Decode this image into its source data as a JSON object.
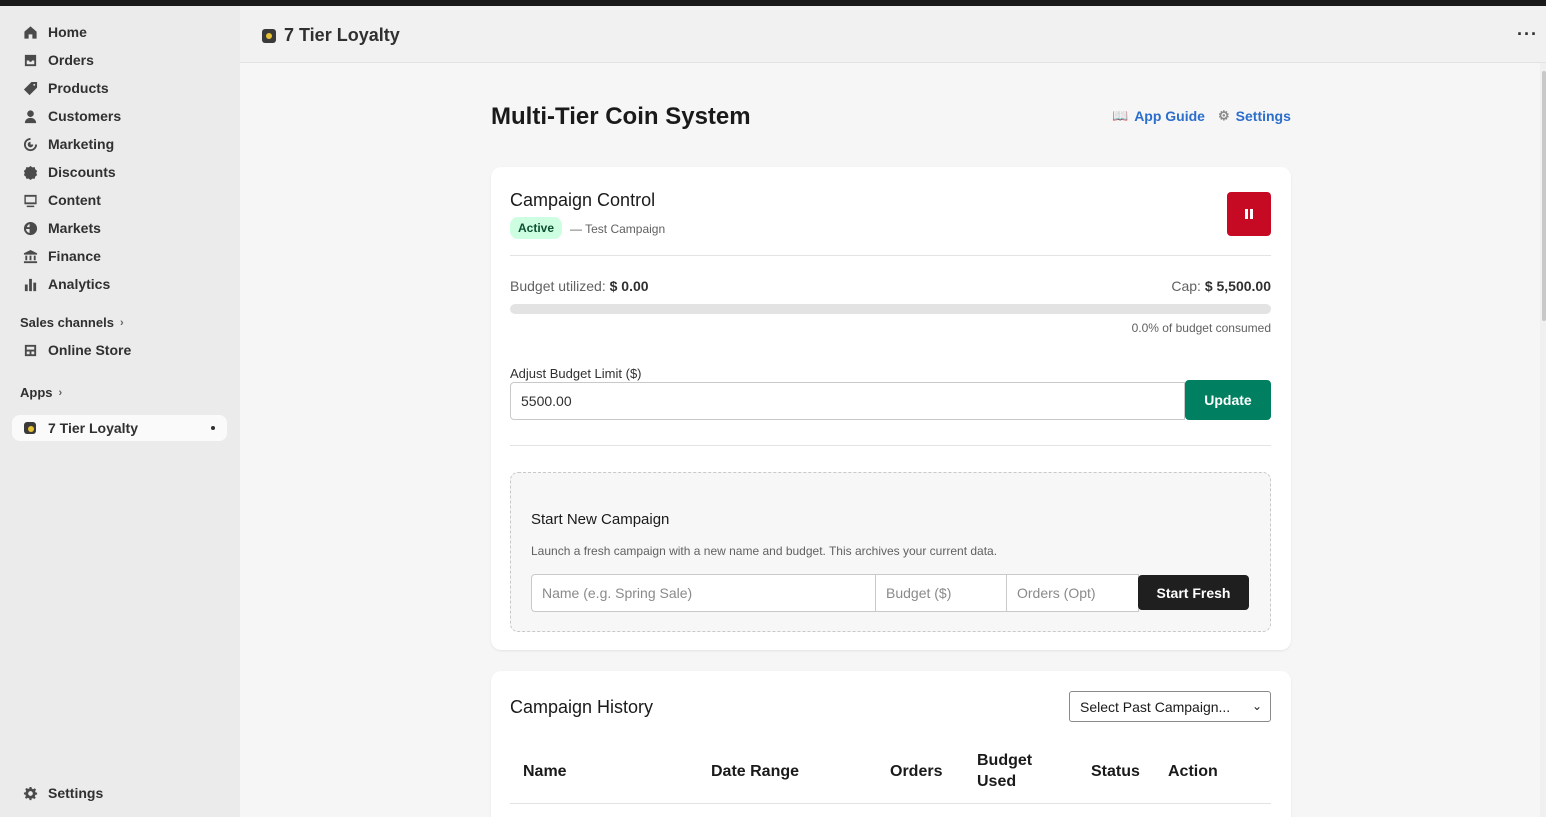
{
  "sidebar": {
    "items": [
      {
        "label": "Home",
        "icon": "home-icon"
      },
      {
        "label": "Orders",
        "icon": "orders-icon"
      },
      {
        "label": "Products",
        "icon": "tag-icon"
      },
      {
        "label": "Customers",
        "icon": "person-icon"
      },
      {
        "label": "Marketing",
        "icon": "target-icon"
      },
      {
        "label": "Discounts",
        "icon": "discount-icon"
      },
      {
        "label": "Content",
        "icon": "content-icon"
      },
      {
        "label": "Markets",
        "icon": "globe-icon"
      },
      {
        "label": "Finance",
        "icon": "bank-icon"
      },
      {
        "label": "Analytics",
        "icon": "bar-chart-icon"
      }
    ],
    "sales_channels_label": "Sales channels",
    "online_store_label": "Online Store",
    "apps_label": "Apps",
    "app_item_label": "7 Tier Loyalty",
    "settings_label": "Settings"
  },
  "header": {
    "app_title": "7 Tier Loyalty",
    "more_label": "···"
  },
  "page": {
    "title": "Multi-Tier Coin System",
    "app_guide_label": "App Guide",
    "settings_link_label": "Settings"
  },
  "campaign_control": {
    "title": "Campaign Control",
    "status_badge": "Active",
    "campaign_name": "— Test Campaign",
    "budget_utilized_label": "Budget utilized:",
    "budget_utilized_value": "$ 0.00",
    "cap_label": "Cap:",
    "cap_value": "$ 5,500.00",
    "progress_fraction": 0.0,
    "progress_text": "0.0% of budget consumed",
    "adjust_label": "Adjust Budget Limit ($)",
    "budget_input_value": "5500.00",
    "update_label": "Update"
  },
  "new_campaign": {
    "title": "Start New Campaign",
    "description": "Launch a fresh campaign with a new name and budget. This archives your current data.",
    "name_placeholder": "Name (e.g. Spring Sale)",
    "budget_placeholder": "Budget ($)",
    "orders_placeholder": "Orders (Opt)",
    "start_label": "Start Fresh"
  },
  "history": {
    "title": "Campaign History",
    "select_value": "Select Past Campaign...",
    "columns": [
      "Name",
      "Date Range",
      "Orders",
      "Budget Used",
      "Status",
      "Action"
    ]
  },
  "colors": {
    "accent_green": "#008060",
    "danger_red": "#c70a24",
    "link_blue": "#2c6ecb",
    "badge_green_bg": "#cdfee1"
  }
}
